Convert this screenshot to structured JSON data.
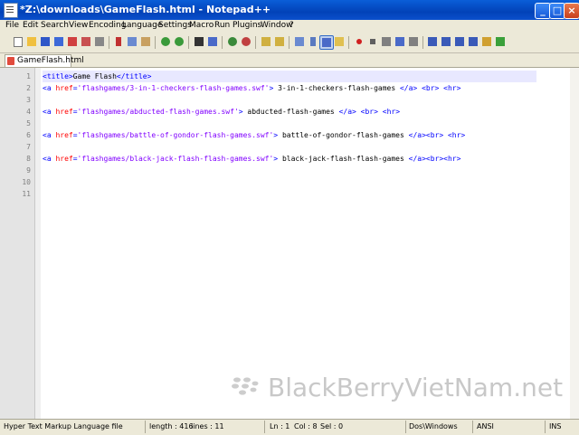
{
  "window": {
    "title": "*Z:\\downloads\\GameFlash.html - Notepad++"
  },
  "menu": [
    "File",
    "Edit",
    "Search",
    "View",
    "Encoding",
    "Language",
    "Settings",
    "Macro",
    "Run",
    "Plugins",
    "Window",
    "?"
  ],
  "toolbar": {
    "icons": [
      "new-file",
      "open-file",
      "save",
      "save-all",
      "close",
      "close-all",
      "print",
      "cut",
      "copy",
      "paste",
      "undo",
      "redo",
      "find",
      "replace",
      "zoom-in",
      "zoom-out",
      "sync-vertical",
      "sync-horizontal",
      "word-wrap",
      "show-all-chars",
      "indent-guide",
      "user-defined-language",
      "fold",
      "record-macro",
      "stop-recording",
      "playback-macro",
      "run-macro-multiple",
      "save-macro",
      "move-up",
      "move-down",
      "bookmark",
      "spell-check"
    ]
  },
  "tabs": [
    {
      "label": "GameFlash.html"
    }
  ],
  "editor": {
    "line_numbers": [
      "1",
      "2",
      "3",
      "4",
      "5",
      "6",
      "7",
      "8",
      "9",
      "10",
      "11"
    ],
    "lines": [
      {
        "parts": [
          [
            "tag",
            "<title>"
          ],
          [
            "txt",
            "Game Flash"
          ],
          [
            "tag",
            "</title>"
          ]
        ]
      },
      {
        "parts": [
          [
            "tag",
            "<a "
          ],
          [
            "attr",
            "href"
          ],
          [
            "tag",
            "="
          ],
          [
            "val",
            "'flashgames/3-in-1-checkers-flash-games.swf'"
          ],
          [
            "tag",
            "> "
          ],
          [
            "txt",
            "3-in-1-checkers-flash-games "
          ],
          [
            "tag",
            "</a>"
          ],
          [
            "txt",
            " "
          ],
          [
            "tag",
            "<br>"
          ],
          [
            "txt",
            " "
          ],
          [
            "tag",
            "<hr>"
          ]
        ]
      },
      {
        "parts": []
      },
      {
        "parts": [
          [
            "tag",
            "<a "
          ],
          [
            "attr",
            "href"
          ],
          [
            "tag",
            "="
          ],
          [
            "val",
            "'flashgames/abducted-flash-games.swf'"
          ],
          [
            "tag",
            "> "
          ],
          [
            "txt",
            "abducted-flash-games "
          ],
          [
            "tag",
            "</a>"
          ],
          [
            "txt",
            " "
          ],
          [
            "tag",
            "<br>"
          ],
          [
            "txt",
            " "
          ],
          [
            "tag",
            "<hr>"
          ]
        ]
      },
      {
        "parts": []
      },
      {
        "parts": [
          [
            "tag",
            "<a "
          ],
          [
            "attr",
            "href"
          ],
          [
            "tag",
            "="
          ],
          [
            "val",
            "'flashgames/battle-of-gondor-flash-games.swf'"
          ],
          [
            "tag",
            "> "
          ],
          [
            "txt",
            "battle-of-gondor-flash-games "
          ],
          [
            "tag",
            "</a><br>"
          ],
          [
            "txt",
            " "
          ],
          [
            "tag",
            "<hr>"
          ]
        ]
      },
      {
        "parts": []
      },
      {
        "parts": [
          [
            "tag",
            "<a "
          ],
          [
            "attr",
            "href"
          ],
          [
            "tag",
            "="
          ],
          [
            "val",
            "'flashgames/black-jack-flash-flash-games.swf'"
          ],
          [
            "tag",
            "> "
          ],
          [
            "txt",
            "black-jack-flash-flash-games "
          ],
          [
            "tag",
            "</a><br><hr>"
          ]
        ]
      },
      {
        "parts": []
      },
      {
        "parts": []
      },
      {
        "parts": []
      }
    ]
  },
  "watermark": "BlackBerryVietNam.net",
  "status": {
    "file_type": "Hyper Text Markup Language file",
    "length": "length : 416",
    "lines": "lines : 11",
    "ln": "Ln : 1",
    "col": "Col : 8",
    "sel": "Sel : 0",
    "eol": "Dos\\Windows",
    "encoding": "ANSI",
    "mode": "INS"
  },
  "colors": {
    "tag": "#0000ff",
    "attribute": "#ff0000",
    "value": "#8000ff",
    "current_line": "#e8e8ff"
  }
}
